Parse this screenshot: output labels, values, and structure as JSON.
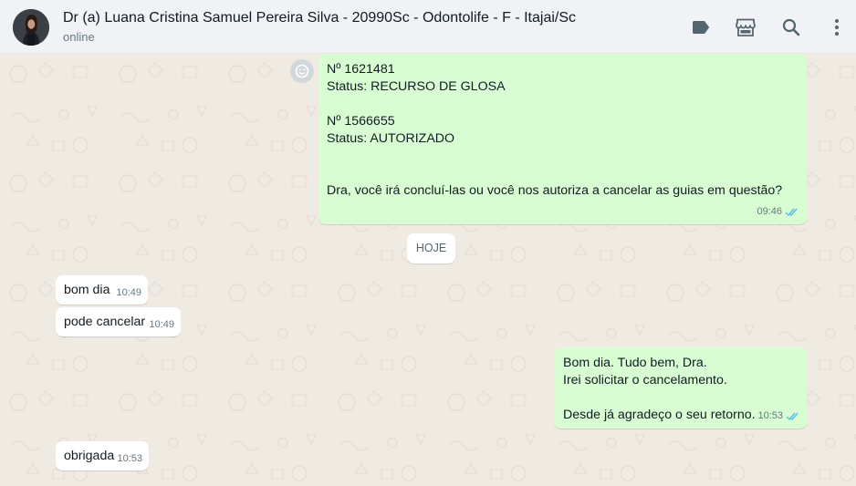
{
  "header": {
    "contact_name": "Dr (a) Luana Cristina Samuel Pereira Silva - 20990Sc - Odontolife - F - Itajai/Sc",
    "status": "online",
    "icons": [
      "label-icon",
      "store-icon",
      "search-icon",
      "menu-icon"
    ]
  },
  "messages": {
    "m1": {
      "lines": [
        "Nº 1621481",
        "Status: RECURSO DE GLOSA",
        "",
        "Nº 1566655",
        "Status: AUTORIZADO",
        "",
        "",
        "Dra, você irá concluí-las ou você nos autoriza a cancelar as guias em questão?"
      ],
      "time": "09:46",
      "direction": "outgoing",
      "read": true
    },
    "date_divider": "HOJE",
    "m2": {
      "text": "bom dia",
      "time": "10:49",
      "direction": "incoming"
    },
    "m3": {
      "text": "pode cancelar",
      "time": "10:49",
      "direction": "incoming"
    },
    "m4": {
      "lines": [
        "Bom dia. Tudo bem, Dra.",
        "Irei solicitar o cancelamento.",
        "",
        "Desde já agradeço o seu retorno."
      ],
      "time": "10:53",
      "direction": "outgoing",
      "read": true
    },
    "m5": {
      "text": "obrigada",
      "time": "10:53",
      "direction": "incoming"
    }
  },
  "colors": {
    "outgoing_bubble": "#d9fdd3",
    "incoming_bubble": "#ffffff",
    "chat_background": "#efeae2",
    "header_background": "#f0f2f5",
    "read_tick": "#53bdeb"
  }
}
